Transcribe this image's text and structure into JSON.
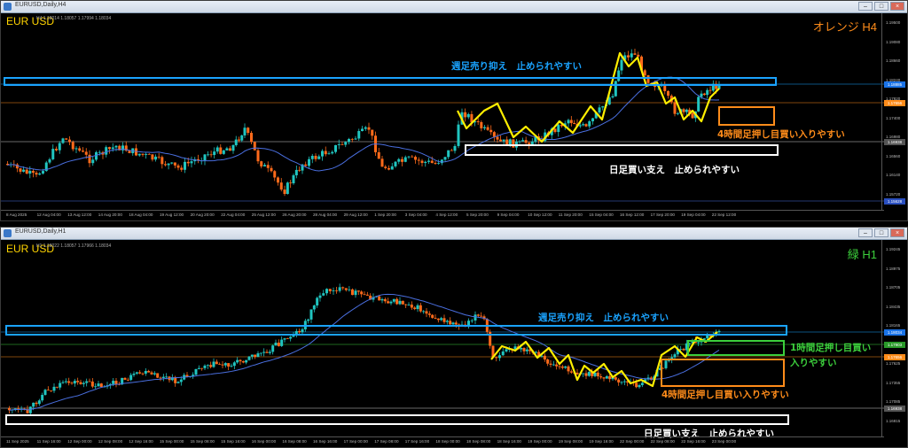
{
  "windows": [
    {
      "title": "EURUSD,Daily,H4",
      "symbol": "EUR USD",
      "ohlc": "H4  1.18014  1.18057  1.17994  1.18034",
      "timeframe_label": "オレンジ H4",
      "timeframe_color": "#ff8c1a",
      "annotations": {
        "weekly_resistance": "週足売り抑え　止められやすい",
        "h4_push_buy": "4時間足押し目買い入りやすい",
        "daily_support": "日足買い支え　止められやすい"
      },
      "price_tags": [
        "1.18885",
        "1.17656",
        "1.16938",
        "1.15628"
      ],
      "y_ticks": [
        "1.19500",
        "1.19080",
        "1.18660",
        "1.18240",
        "1.17820",
        "1.17400",
        "1.16980",
        "1.16560",
        "1.16140",
        "1.15720"
      ],
      "x_ticks": [
        "8 Aug 2025",
        "12 Aug 04:00",
        "13 Aug 12:00",
        "14 Aug 20:00",
        "18 Aug 04:00",
        "19 Aug 12:00",
        "20 Aug 20:00",
        "22 Aug 04:00",
        "25 Aug 12:00",
        "26 Aug 20:00",
        "28 Aug 04:00",
        "29 Aug 12:00",
        "1 Sep 20:00",
        "3 Sep 04:00",
        "4 Sep 12:00",
        "5 Sep 20:00",
        "9 Sep 04:00",
        "10 Sep 12:00",
        "11 Sep 20:00",
        "15 Sep 04:00",
        "16 Sep 12:00",
        "17 Sep 20:00",
        "19 Sep 04:00",
        "22 Sep 12:00"
      ]
    },
    {
      "title": "EURUSD,Daily,H1",
      "symbol": "EUR USD",
      "ohlc": "H1  1.18022  1.18057  1.17966  1.18034",
      "timeframe_label": "緑 H1",
      "timeframe_color": "#3ccf3c",
      "annotations": {
        "weekly_resistance": "週足売り抑え　止められやすい",
        "h1_push_buy_line1": "1時間足押し目買い",
        "h1_push_buy_line2": "入りやすい",
        "h4_push_buy": "4時間足押し目買い入りやすい",
        "daily_support": "日足買い支え　止められやすい"
      },
      "price_tags": [
        "1.18034",
        "1.17903",
        "1.17656",
        "1.16938"
      ],
      "y_ticks": [
        "1.19245",
        "1.18975",
        "1.18705",
        "1.18435",
        "1.18165",
        "1.17895",
        "1.17625",
        "1.17355",
        "1.17085",
        "1.16815"
      ],
      "x_ticks": [
        "11 Sep 2025",
        "11 Sep 16:00",
        "12 Sep 00:00",
        "12 Sep 08:00",
        "12 Sep 16:00",
        "15 Sep 00:00",
        "15 Sep 08:00",
        "15 Sep 16:00",
        "16 Sep 00:00",
        "16 Sep 08:00",
        "16 Sep 16:00",
        "17 Sep 00:00",
        "17 Sep 08:00",
        "17 Sep 16:00",
        "18 Sep 00:00",
        "18 Sep 08:00",
        "18 Sep 16:00",
        "19 Sep 00:00",
        "19 Sep 08:00",
        "19 Sep 16:00",
        "22 Sep 00:00",
        "22 Sep 08:00",
        "22 Sep 16:00",
        "23 Sep 00:00"
      ]
    }
  ],
  "colors": {
    "bull": "#20c5c0",
    "bear": "#ff6a1a",
    "ma": "#4a6fe0",
    "zigzag": "#ffee00",
    "weekly_zone": "#1aa3ff",
    "daily_zone": "#ffffff",
    "h4_zone": "#ff8c1a",
    "h1_zone": "#3ccf3c"
  }
}
